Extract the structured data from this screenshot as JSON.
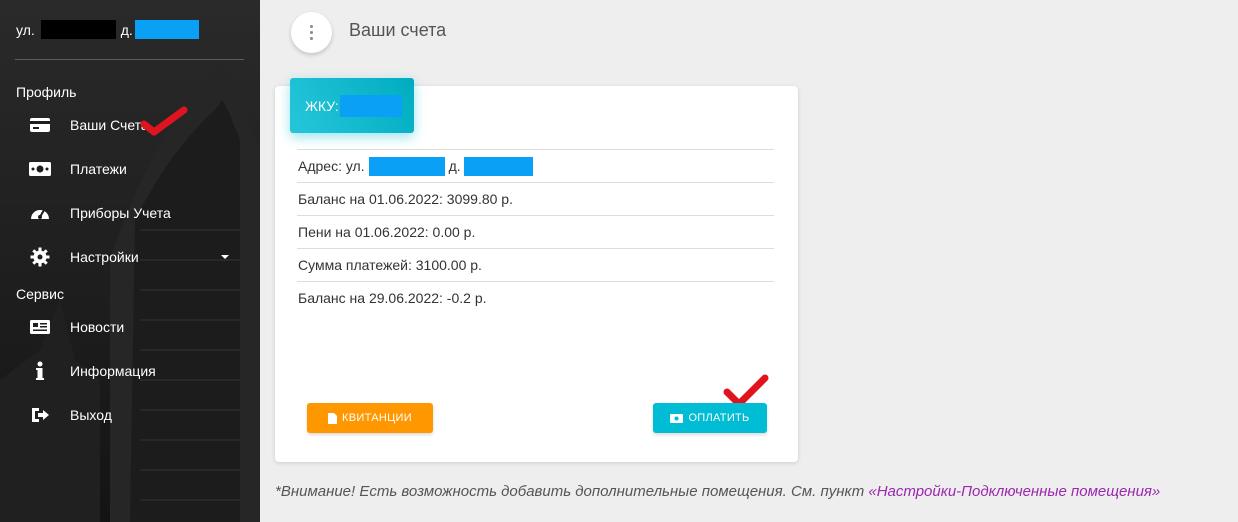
{
  "sidebar": {
    "address_prefix": "ул.",
    "address_house_prefix": "д.",
    "sections": {
      "profile": "Профиль",
      "service": "Сервис"
    },
    "items": [
      {
        "label": "Ваши Счета",
        "icon": "credit-card-icon"
      },
      {
        "label": "Платежи",
        "icon": "money-icon"
      },
      {
        "label": "Приборы Учета",
        "icon": "speedometer-icon"
      },
      {
        "label": "Настройки",
        "icon": "gear-icon"
      },
      {
        "label": "Новости",
        "icon": "newspaper-icon"
      },
      {
        "label": "Информация",
        "icon": "info-icon"
      },
      {
        "label": "Выход",
        "icon": "logout-icon"
      }
    ]
  },
  "header": {
    "title": "Ваши счета"
  },
  "card": {
    "header_label": "ЖКУ:",
    "rows": {
      "address_label": "Адрес: ул.",
      "address_house": "д.",
      "balance_start": "Баланс на 01.06.2022: 3099.80 р.",
      "penalty": "Пени на 01.06.2022: 0.00 р.",
      "payments": "Сумма платежей: 3100.00 р.",
      "balance_end": "Баланс на 29.06.2022: -0.2 р."
    },
    "buttons": {
      "receipts": "КВИТАНЦИИ",
      "pay": "ОПЛАТИТЬ"
    }
  },
  "notice": {
    "text": "*Внимание! Есть возможность добавить дополнительные помещения. См. пункт ",
    "link": "«Настройки-Подключенные помещения»"
  },
  "colors": {
    "accent_cyan": "#00bcd4",
    "accent_orange": "#ff9800",
    "link_purple": "#9c27b0",
    "redaction_blue": "#0aa0f5",
    "check_red": "#e0141e"
  }
}
